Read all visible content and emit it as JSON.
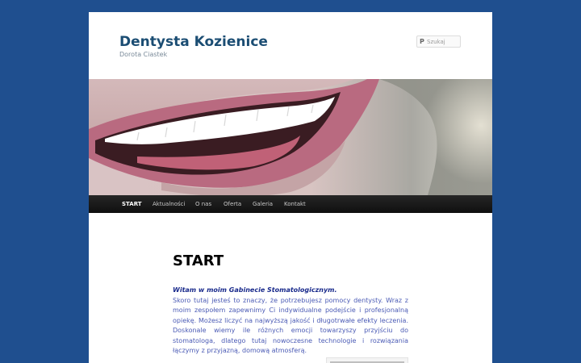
{
  "site": {
    "title": "Dentysta Kozienice",
    "description": "Dorota Ciastek"
  },
  "search": {
    "placeholder": "Szukaj",
    "icon": "search-icon"
  },
  "nav": {
    "items": [
      {
        "label": "START",
        "active": true
      },
      {
        "label": "Aktualności",
        "active": false
      },
      {
        "label": "O nas",
        "active": false
      },
      {
        "label": "Oferta",
        "active": false
      },
      {
        "label": "Galeria",
        "active": false
      },
      {
        "label": "Kontakt",
        "active": false
      }
    ]
  },
  "content": {
    "title": "START",
    "intro": "Witam w moim Gabinecie Stomatologicznym.",
    "body": "Skoro tutaj jesteś to znaczy, że potrzebujesz pomocy dentysty. Wraz z moim zespołem zapewnimy Ci indywidualne podejście i profesjonalną opiekę. Możesz liczyć na najwyższą jakość i długotrwałe efekty leczenia. Doskonale wiemy ile różnych emocji towarzyszy przyjściu do stomatologa, dlatego tutaj nowoczesne technologie i rozwiązania łączymy z przyjazną, domową atmosferą."
  },
  "colors": {
    "background": "#1f4f8f",
    "title": "#1b4d73",
    "nav_bg": "#1a1a1a",
    "intro_text": "#1a2b8c",
    "body_text": "#4b5bb5"
  }
}
